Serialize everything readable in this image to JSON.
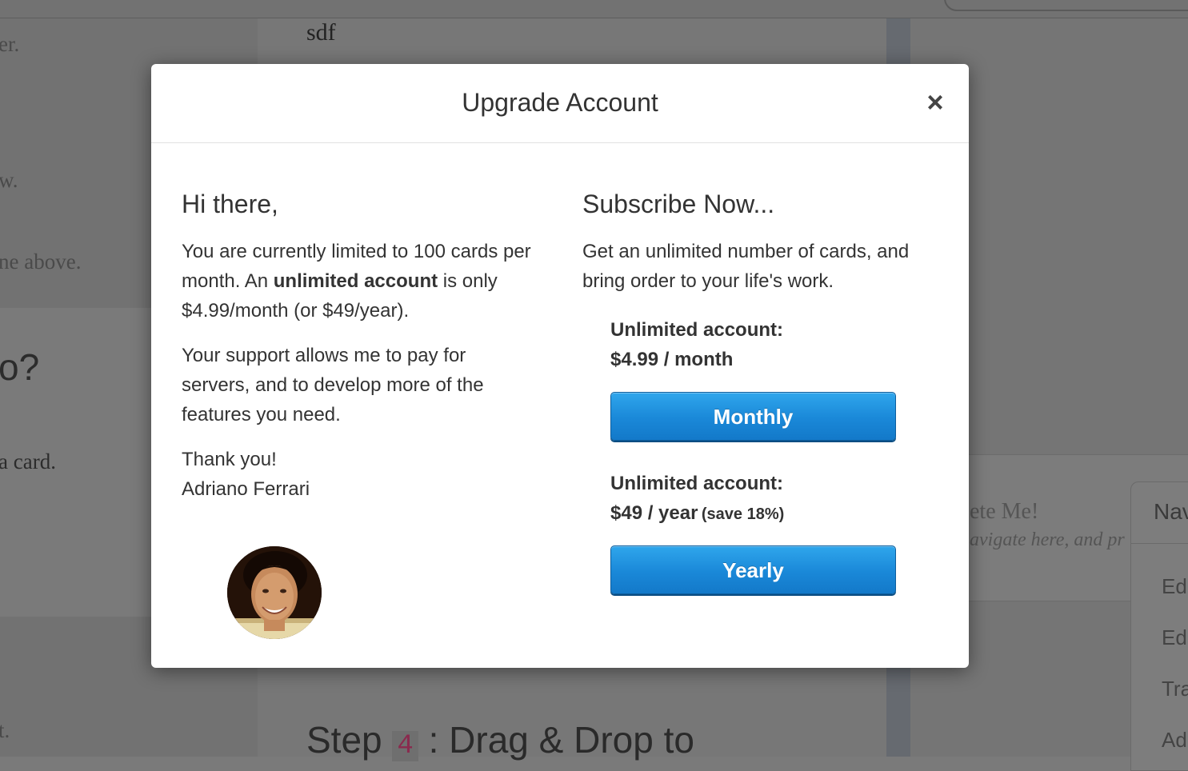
{
  "background": {
    "left_fragments": [
      "er.",
      "w.",
      "ne above.",
      "o?",
      "a card.",
      "t."
    ],
    "center_top": "sdf",
    "center_bottom_prefix": "Step",
    "center_bottom_num": "4",
    "center_bottom_suffix": ": Drag & Drop to",
    "right_card_title": "ete Me!",
    "right_card_sub": "avigate here, and pr",
    "right_nav_title": "Nav",
    "right_nav_items": [
      "Ed",
      "Ed",
      "Tra",
      "Ad"
    ]
  },
  "modal": {
    "title": "Upgrade Account",
    "close_glyph": "×",
    "left": {
      "greeting": "Hi there,",
      "p1_a": "You are currently limited to 100 cards per month. An ",
      "p1_b": "unlimited account",
      "p1_c": " is only $4.99/month (or $49/year).",
      "p2": "Your support allows me to pay for servers, and to develop more of the features you need.",
      "thanks": "Thank you!",
      "signature": "Adriano Ferrari"
    },
    "right": {
      "heading": "Subscribe Now...",
      "intro": "Get an unlimited number of cards, and bring order to your life's work.",
      "plans": [
        {
          "label": "Unlimited account:",
          "price": "$4.99 / month",
          "save": "",
          "button": "Monthly"
        },
        {
          "label": "Unlimited account:",
          "price": "$49 / year",
          "save": "(save 18%)",
          "button": "Yearly"
        }
      ]
    }
  },
  "colors": {
    "button_blue": "#1a88d8",
    "overlay": "#7a7a7a",
    "modal_bg": "#ffffff"
  }
}
